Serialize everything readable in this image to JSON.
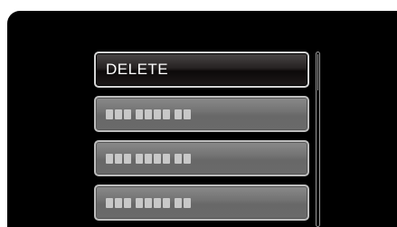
{
  "menu": {
    "items": [
      {
        "label": "DELETE",
        "state": "selected"
      },
      {
        "label": "",
        "state": "inactive",
        "obscured": true
      },
      {
        "label": "",
        "state": "inactive",
        "obscured": true
      },
      {
        "label": "",
        "state": "inactive",
        "obscured": true
      }
    ]
  },
  "colors": {
    "background": "#000000",
    "selected_item": "#1a1616",
    "inactive_item": "#707070",
    "border_light": "#d4d4d4"
  },
  "scrollbar": {
    "position_fraction": 0.0
  }
}
